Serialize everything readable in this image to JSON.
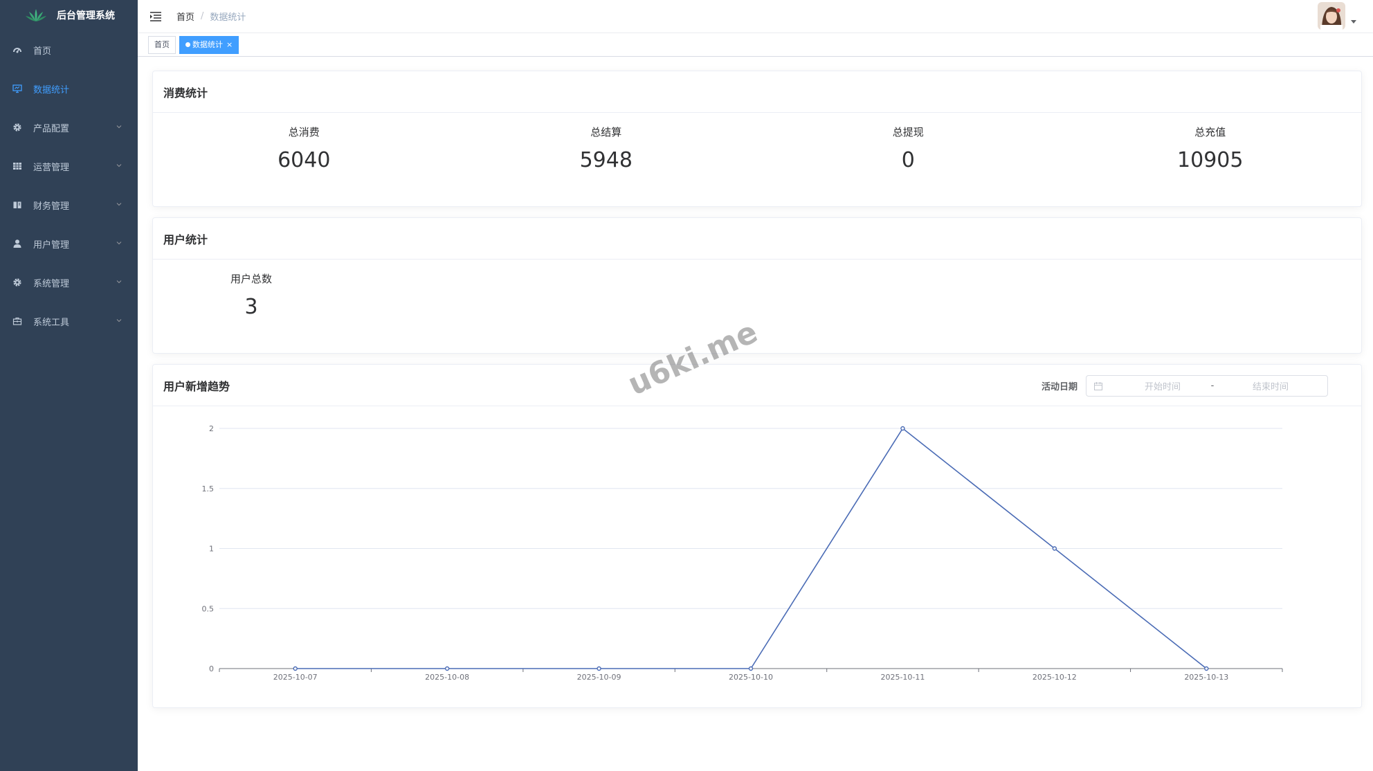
{
  "app": {
    "title": "后台管理系统"
  },
  "sidebar": {
    "items": [
      {
        "label": "首页",
        "icon": "dashboard-icon",
        "active": false,
        "expandable": false
      },
      {
        "label": "数据统计",
        "icon": "monitor-icon",
        "active": true,
        "expandable": false
      },
      {
        "label": "产品配置",
        "icon": "gear-icon",
        "active": false,
        "expandable": true
      },
      {
        "label": "运营管理",
        "icon": "grid-icon",
        "active": false,
        "expandable": true
      },
      {
        "label": "财务管理",
        "icon": "book-icon",
        "active": false,
        "expandable": true
      },
      {
        "label": "用户管理",
        "icon": "user-icon",
        "active": false,
        "expandable": true
      },
      {
        "label": "系统管理",
        "icon": "gear-icon",
        "active": false,
        "expandable": true
      },
      {
        "label": "系统工具",
        "icon": "toolbox-icon",
        "active": false,
        "expandable": true
      }
    ]
  },
  "navbar": {
    "breadcrumb": {
      "home": "首页",
      "separator": "/",
      "current": "数据统计"
    }
  },
  "tags": [
    {
      "label": "首页",
      "active": false
    },
    {
      "label": "数据统计",
      "active": true,
      "close": "×"
    }
  ],
  "consumption": {
    "title": "消费统计",
    "stats": [
      {
        "label": "总消费",
        "value": "6040"
      },
      {
        "label": "总结算",
        "value": "5948"
      },
      {
        "label": "总提现",
        "value": "0"
      },
      {
        "label": "总充值",
        "value": "10905"
      }
    ]
  },
  "users": {
    "title": "用户统计",
    "stats": [
      {
        "label": "用户总数",
        "value": "3"
      }
    ]
  },
  "trend": {
    "title": "用户新增趋势",
    "filter_label": "活动日期",
    "start_placeholder": "开始时间",
    "range_separator": "-",
    "end_placeholder": "结束时间"
  },
  "chart_data": {
    "type": "line",
    "x": [
      "2025-10-07",
      "2025-10-08",
      "2025-10-09",
      "2025-10-10",
      "2025-10-11",
      "2025-10-12",
      "2025-10-13"
    ],
    "series": [
      {
        "values": [
          0,
          0,
          0,
          0,
          2,
          1,
          0
        ]
      }
    ],
    "y_ticks": [
      "0",
      "0.5",
      "1",
      "1.5",
      "2"
    ],
    "ylim": [
      0,
      2
    ],
    "grid": true,
    "color": "#4a6bb5"
  },
  "watermark": "u6ki.me",
  "colors": {
    "sidebar_bg": "#304156",
    "sidebar_text": "#bfcbd9",
    "accent": "#409eff"
  }
}
